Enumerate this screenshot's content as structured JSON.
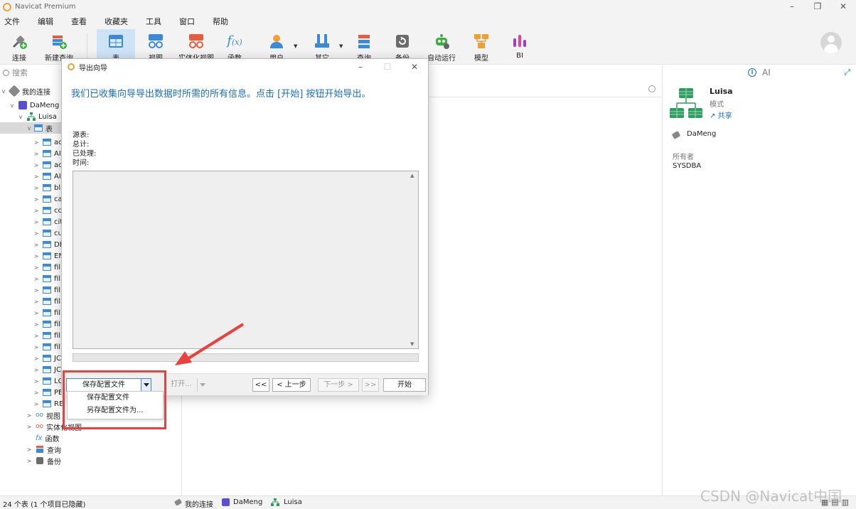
{
  "window": {
    "title": "Navicat Premium"
  },
  "menu": [
    "文件",
    "编辑",
    "查看",
    "收藏夹",
    "工具",
    "窗口",
    "帮助"
  ],
  "toolbar": {
    "items": [
      "连接",
      "新建查询",
      "表",
      "视图",
      "实体化视图",
      "函数",
      "用户",
      "其它",
      "查询",
      "备份",
      "自动运行",
      "模型",
      "BI"
    ]
  },
  "leftpane": {
    "search_placeholder": "搜索",
    "tree": {
      "root": "我的连接",
      "connection": "DaMeng",
      "schema": "Luisa",
      "tables_node": "表",
      "table_items": [
        "ac",
        "AI",
        "ac",
        "AI",
        "bl",
        "ca",
        "cc",
        "cit",
        "cu",
        "DE",
        "EN",
        "fil",
        "fil",
        "fil",
        "fil",
        "fil",
        "fil",
        "fil",
        "fil",
        "JC",
        "JC",
        "LC",
        "PE",
        "RE"
      ],
      "views": "视图",
      "materialized": "实体化视图",
      "functions": "函数",
      "queries": "查询",
      "backups": "备份"
    }
  },
  "rightpane": {
    "ai_label": "AI",
    "schema_name": "Luisa",
    "schema_type": "模式",
    "share": "共享",
    "connection": "DaMeng",
    "owner_label": "所有者",
    "owner_value": "SYSDBA"
  },
  "statusbar": {
    "count": "24 个表 (1 个项目已隐藏)",
    "crumb1": "我的连接",
    "crumb2": "DaMeng",
    "crumb3": "Luisa"
  },
  "dialog": {
    "title": "导出向导",
    "heading": "我们已收集向导导出数据时所需的所有信息。点击 [开始] 按钮开始导出。",
    "lines": [
      "源表:",
      "总计:",
      "已处理:",
      "时间:"
    ],
    "save_combo": "保存配置文件",
    "open_button": "打开...",
    "first_button": "<<",
    "prev_button": "< 上一步",
    "next_button": "下一步 >",
    "last_button": ">>",
    "start_button": "开始"
  },
  "popup_menu": [
    "保存配置文件",
    "另存配置文件为..."
  ],
  "watermark": "CSDN @Navicat中国",
  "colors": {
    "accent": "#1a6fc4",
    "highlight": "#e8413e",
    "selection": "#cfe3f7"
  }
}
